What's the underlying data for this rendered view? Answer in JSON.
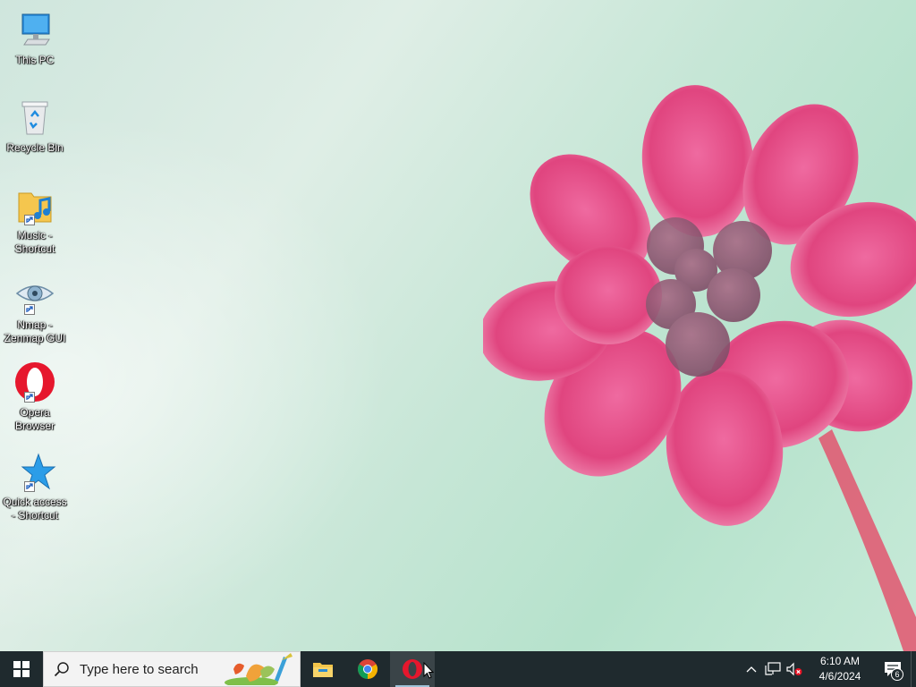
{
  "desktop": {
    "icons": [
      {
        "label": "This PC",
        "icon": "computer-icon",
        "shortcut": false
      },
      {
        "label": "Recycle Bin",
        "icon": "recycle-bin-icon",
        "shortcut": false
      },
      {
        "label": "Music - Shortcut",
        "icon": "music-folder-icon",
        "shortcut": true
      },
      {
        "label": "Nmap - Zenmap GUI",
        "icon": "nmap-eye-icon",
        "shortcut": true
      },
      {
        "label": "Opera Browser",
        "icon": "opera-icon",
        "shortcut": true
      },
      {
        "label": "Quick access - Shortcut",
        "icon": "star-icon",
        "shortcut": true
      }
    ]
  },
  "taskbar": {
    "search_placeholder": "Type here to search",
    "apps": [
      {
        "name": "File Explorer",
        "icon": "file-explorer-icon",
        "running": false
      },
      {
        "name": "Google Chrome",
        "icon": "chrome-icon",
        "running": false
      },
      {
        "name": "Opera",
        "icon": "opera-icon",
        "running": true
      }
    ],
    "tray": {
      "time": "6:10 AM",
      "date": "4/6/2024",
      "notification_count": "6"
    }
  },
  "colors": {
    "taskbar": "#1f2a2e",
    "flower": "#e0457f",
    "wallpaper": "#c6e6d6"
  }
}
